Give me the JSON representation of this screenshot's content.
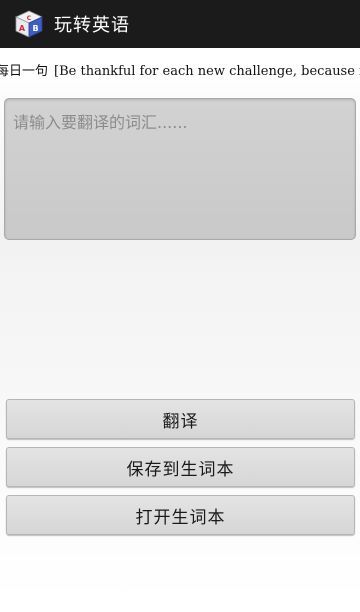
{
  "app": {
    "title": "玩转英语",
    "icon": "abc-cube-icon"
  },
  "daily": {
    "label": "每日一句",
    "sentence": "[Be thankful for each new challenge, because it will build your strength and character.]"
  },
  "input": {
    "placeholder": "请输入要翻译的词汇......",
    "value": ""
  },
  "buttons": {
    "translate": "翻译",
    "save": "保存到生词本",
    "open": "打开生词本"
  },
  "colors": {
    "titlebar": "#1b1b1b",
    "input_bg": "#cccccc",
    "button_bg": "#dddddd"
  }
}
